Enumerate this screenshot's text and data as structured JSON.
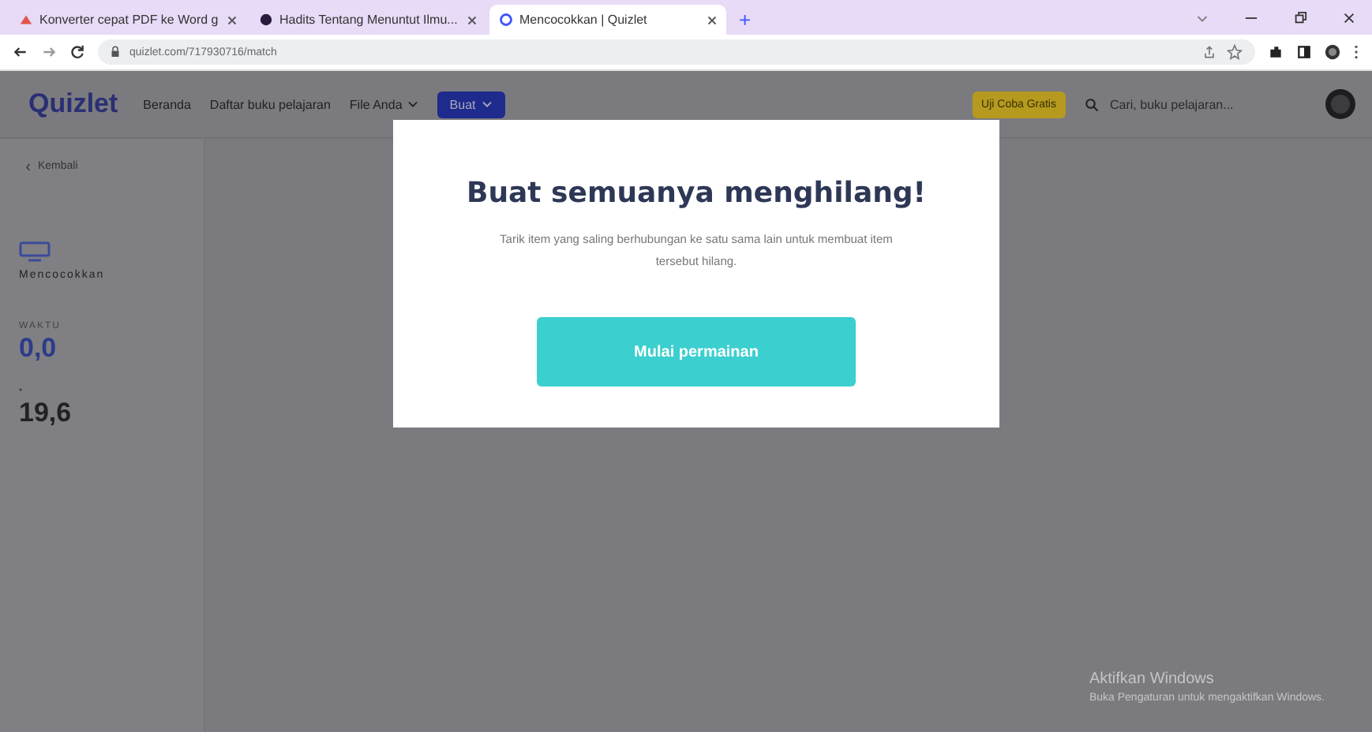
{
  "browser": {
    "tabs": [
      {
        "title": "Konverter cepat PDF ke Word g",
        "selected": false,
        "kind": "pdf"
      },
      {
        "title": "Hadits Tentang Menuntut Ilmu...",
        "selected": false,
        "kind": "dot"
      },
      {
        "title": "Mencocokkan | Quizlet",
        "selected": true,
        "kind": "quizlet"
      }
    ],
    "new_tab": "+",
    "address": "quizlet.com/717930716/match"
  },
  "header": {
    "logo": "Quizlet",
    "nav": [
      {
        "label": "Beranda",
        "dropdown": false
      },
      {
        "label": "Daftar buku pelajaran",
        "dropdown": false
      },
      {
        "label": "File Anda",
        "dropdown": true
      }
    ],
    "create_button": "Buat",
    "trial_button": "Uji Coba Gratis",
    "search": {
      "placeholder": "Cari, buku pelajaran..."
    }
  },
  "sidebar": {
    "back": "Kembali",
    "mode": "Mencocokkan",
    "time_label": "WAKTU",
    "time": "0,0",
    "best_label": "•",
    "best": "19,6"
  },
  "modal": {
    "title": "Buat semuanya menghilang!",
    "text": "Tarik item yang saling berhubungan ke satu sama lain untuk membuat item tersebut hilang.",
    "button": "Mulai permainan"
  },
  "os_notice": {
    "title": "Aktifkan Windows",
    "text": "Buka Pengaturan untuk mengaktifkan Windows."
  }
}
